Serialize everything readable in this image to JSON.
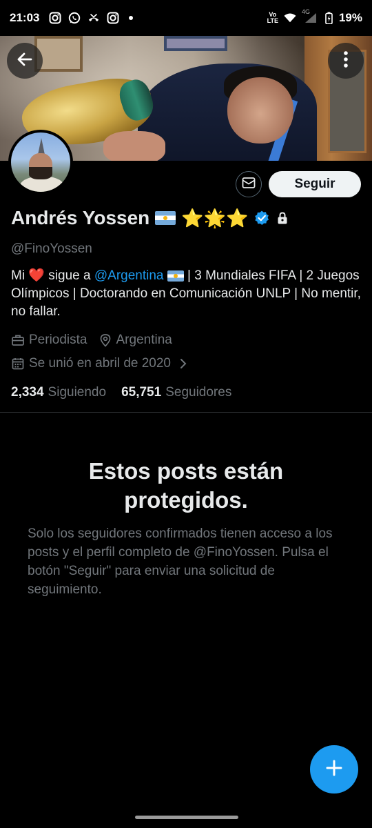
{
  "status_bar": {
    "time": "21:03",
    "left_icons": [
      "instagram-icon",
      "whatsapp-icon",
      "missed-call-icon",
      "instagram-icon"
    ],
    "volte": "Vo\nLTE",
    "network": "4G",
    "battery": "19%"
  },
  "profile": {
    "name": "Andrés Yossen",
    "name_emojis": "⭐🌟⭐",
    "handle": "@FinoYossen",
    "bio_prefix": "Mi",
    "bio_heart": "❤️",
    "bio_mid": "sigue a",
    "bio_mention": "@Argentina",
    "bio_rest": "| 3 Mundiales FIFA | 2 Juegos Olímpicos | Doctorando en Comunicación UNLP | No mentir, no fallar.",
    "profession": "Periodista",
    "location": "Argentina",
    "joined": "Se unió en abril de 2020",
    "following_count": "2,334",
    "following_label": "Siguiendo",
    "followers_count": "65,751",
    "followers_label": "Seguidores"
  },
  "actions": {
    "follow_label": "Seguir"
  },
  "protected": {
    "title": "Estos posts están protegidos.",
    "body": "Solo los seguidores confirmados tienen acceso a los posts y el perfil completo de @FinoYossen. Pulsa el botón \"Seguir\" para enviar una solicitud de seguimiento."
  },
  "colors": {
    "accent": "#1d9bf0",
    "background": "#000000",
    "muted_text": "#71767b"
  }
}
